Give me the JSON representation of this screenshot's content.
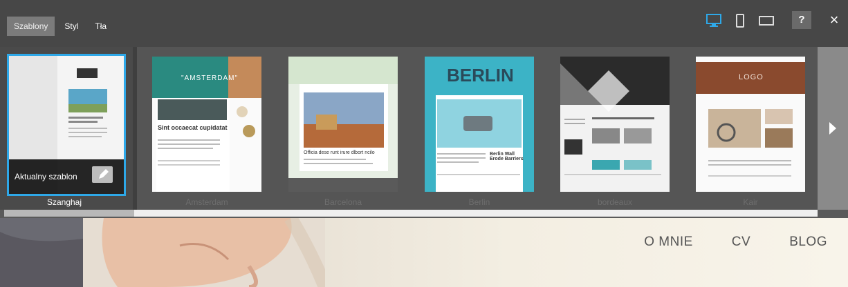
{
  "toolbar": {
    "tabs": [
      "Szablony",
      "Styl",
      "Tła"
    ],
    "active_tab": "Szablony",
    "help_label": "?",
    "close_label": "×",
    "accent": "#2ea8e8"
  },
  "templates": {
    "current_overlay_label": "Aktualny szablon",
    "items": [
      {
        "name": "Szanghaj",
        "selected": true
      },
      {
        "name": "Amsterdam",
        "heading": "\"AMSTERDAM\"",
        "subheading": "Sint occaecat cupidatat"
      },
      {
        "name": "Barcelona",
        "subheading": "Officia dese runt irure dlbort ncilo"
      },
      {
        "name": "Berlin",
        "heading": "BERLIN",
        "subheading": "Berlin Wall Erode Barriers"
      },
      {
        "name": "bordeaux"
      },
      {
        "name": "Kair",
        "heading": "LOGO"
      }
    ]
  },
  "site_preview": {
    "nav": [
      "O MNIE",
      "CV",
      "BLOG"
    ]
  }
}
